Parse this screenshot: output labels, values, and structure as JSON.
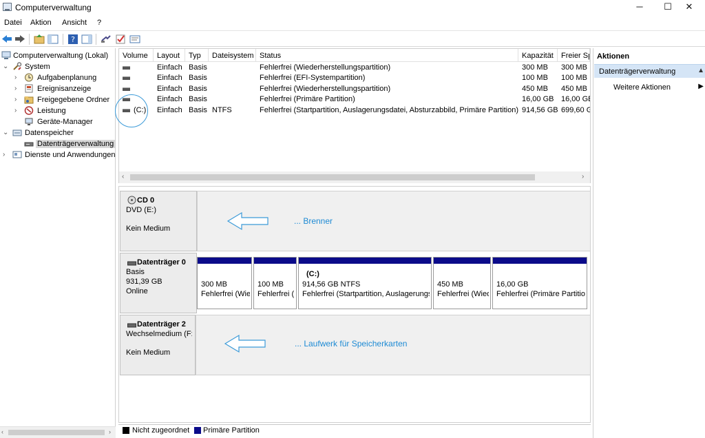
{
  "window": {
    "title": "Computerverwaltung",
    "buttons": [
      "─",
      "☐",
      "✕"
    ]
  },
  "menu": [
    "Datei",
    "Aktion",
    "Ansicht",
    "?"
  ],
  "tree": [
    {
      "label": "Computerverwaltung (Lokal)",
      "icon": "computer-management-icon"
    },
    {
      "label": "System",
      "icon": "tools-icon"
    },
    {
      "label": "Aufgabenplanung",
      "icon": "clock-icon"
    },
    {
      "label": "Ereignisanzeige",
      "icon": "event-viewer-icon"
    },
    {
      "label": "Freigegebene Ordner",
      "icon": "shared-folder-icon"
    },
    {
      "label": "Leistung",
      "icon": "performance-icon"
    },
    {
      "label": "Geräte-Manager",
      "icon": "device-manager-icon"
    },
    {
      "label": "Datenspeicher",
      "icon": "storage-icon"
    },
    {
      "label": "Datenträgerverwaltung",
      "icon": "disk-management-icon"
    },
    {
      "label": "Dienste und Anwendungen",
      "icon": "services-icon"
    }
  ],
  "columns": [
    "Volume",
    "Layout",
    "Typ",
    "Dateisystem",
    "Status",
    "Kapazität",
    "Freier Sp"
  ],
  "volumes": [
    {
      "volume": "",
      "layout": "Einfach",
      "type": "Basis",
      "fs": "",
      "status": "Fehlerfrei (Wiederherstellungspartition)",
      "capacity": "300 MB",
      "free": "300 MB"
    },
    {
      "volume": "",
      "layout": "Einfach",
      "type": "Basis",
      "fs": "",
      "status": "Fehlerfrei (EFI-Systempartition)",
      "capacity": "100 MB",
      "free": "100 MB"
    },
    {
      "volume": "",
      "layout": "Einfach",
      "type": "Basis",
      "fs": "",
      "status": "Fehlerfrei (Wiederherstellungspartition)",
      "capacity": "450 MB",
      "free": "450 MB"
    },
    {
      "volume": "",
      "layout": "Einfach",
      "type": "Basis",
      "fs": "",
      "status": "Fehlerfrei (Primäre Partition)",
      "capacity": "16,00 GB",
      "free": "16,00 GB"
    },
    {
      "volume": "(C:)",
      "layout": "Einfach",
      "type": "Basis",
      "fs": "NTFS",
      "status": "Fehlerfrei (Startpartition, Auslagerungsdatei, Absturzabbild, Primäre Partition)",
      "capacity": "914,56 GB",
      "free": "699,60 G"
    }
  ],
  "disks": {
    "cd0": {
      "name": "CD 0",
      "line1": "DVD (E:)",
      "line2": "Kein Medium",
      "annotation": "... Brenner"
    },
    "disk0": {
      "name": "Datenträger 0",
      "line1": "Basis",
      "line2": "931,39 GB",
      "line3": "Online",
      "partitions": [
        {
          "title": "",
          "size": "300 MB",
          "status": "Fehlerfrei (Wiederherstellungspartition)"
        },
        {
          "title": "",
          "size": "100 MB",
          "status": "Fehlerfrei (EFI-Systempartition)"
        },
        {
          "title": "(C:)",
          "size": "914,56 GB NTFS",
          "status": "Fehlerfrei (Startpartition, Auslagerungsdatei, Absturzabbild, Primäre Partition)"
        },
        {
          "title": "",
          "size": "450 MB",
          "status": "Fehlerfrei (Wiederherstellungspartition)"
        },
        {
          "title": "",
          "size": "16,00 GB",
          "status": "Fehlerfrei (Primäre Partition)"
        }
      ]
    },
    "disk2": {
      "name": "Datenträger 2",
      "line1": "Wechselmedium (F:)",
      "line2": "Kein Medium",
      "annotation": "... Laufwerk für Speicherkarten"
    }
  },
  "legend": [
    {
      "label": "Nicht zugeordnet",
      "color": "#000000"
    },
    {
      "label": "Primäre Partition",
      "color": "#0b0b8a"
    }
  ],
  "actions": {
    "header": "Aktionen",
    "selected": "Datenträgerverwaltung",
    "more": "Weitere Aktionen"
  },
  "colors": {
    "accent": "#1d8ad4",
    "selection": "#d5e5f6",
    "primary_partition": "#0b0b8a"
  }
}
